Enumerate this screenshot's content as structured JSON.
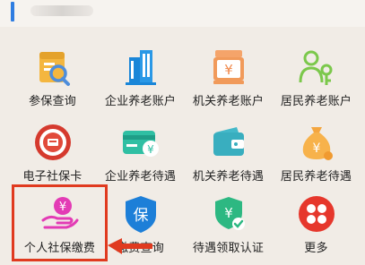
{
  "grid": {
    "rows": [
      [
        {
          "label": "参保查询",
          "icon": "insurance-query-icon"
        },
        {
          "label": "企业养老账户",
          "icon": "office-building-icon"
        },
        {
          "label": "机关养老账户",
          "icon": "yuan-cash-register-icon"
        },
        {
          "label": "居民养老账户",
          "icon": "person-key-icon"
        }
      ],
      [
        {
          "label": "电子社保卡",
          "icon": "social-security-card-badge-icon"
        },
        {
          "label": "企业养老待遇",
          "icon": "yuan-bank-card-icon"
        },
        {
          "label": "机关养老待遇",
          "icon": "wallet-icon"
        },
        {
          "label": "居民养老待遇",
          "icon": "money-bag-icon"
        }
      ],
      [
        {
          "label": "个人社保缴费",
          "icon": "hand-yuan-payment-icon"
        },
        {
          "label": "缴费查询",
          "icon": "bao-shield-icon"
        },
        {
          "label": "待遇领取认证",
          "icon": "yuan-shield-check-icon"
        },
        {
          "label": "更多",
          "icon": "more-grid-icon"
        }
      ]
    ]
  },
  "highlight_color": "#e03a1f"
}
